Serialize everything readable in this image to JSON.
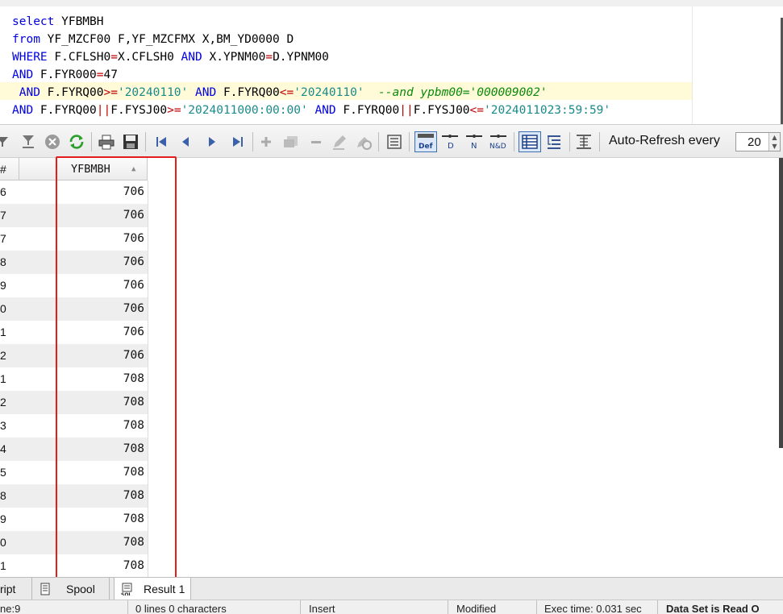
{
  "sql": {
    "lines": [
      [
        {
          "t": "select",
          "c": "kw"
        },
        {
          "t": " YFBMBH",
          "c": ""
        }
      ],
      [
        {
          "t": "from",
          "c": "kw"
        },
        {
          "t": " YF_MZCF00 F,YF_MZCFMX X,BM_YD0000 D",
          "c": ""
        }
      ],
      [
        {
          "t": "WHERE",
          "c": "kw"
        },
        {
          "t": " F.CFLSH0",
          "c": ""
        },
        {
          "t": "=",
          "c": "op"
        },
        {
          "t": "X.CFLSH0 ",
          "c": ""
        },
        {
          "t": "AND",
          "c": "kw"
        },
        {
          "t": " X.YPNM00",
          "c": ""
        },
        {
          "t": "=",
          "c": "op"
        },
        {
          "t": "D.YPNM00",
          "c": ""
        }
      ],
      [
        {
          "t": "AND",
          "c": "kw"
        },
        {
          "t": " F.FYR000",
          "c": ""
        },
        {
          "t": "=",
          "c": "op"
        },
        {
          "t": "47",
          "c": ""
        }
      ],
      [
        {
          "t": " AND",
          "c": "kw"
        },
        {
          "t": " F.FYRQ00",
          "c": ""
        },
        {
          "t": ">=",
          "c": "op"
        },
        {
          "t": "'20240110'",
          "c": "str"
        },
        {
          "t": " ",
          "c": ""
        },
        {
          "t": "AND",
          "c": "kw"
        },
        {
          "t": " F.FYRQ00",
          "c": ""
        },
        {
          "t": "<=",
          "c": "op"
        },
        {
          "t": "'20240110'",
          "c": "str"
        },
        {
          "t": "  --and ypbm00='000009002'",
          "c": "cm"
        }
      ],
      [
        {
          "t": "AND",
          "c": "kw"
        },
        {
          "t": " F.FYRQ00",
          "c": ""
        },
        {
          "t": "||",
          "c": "op"
        },
        {
          "t": "F.FYSJ00",
          "c": ""
        },
        {
          "t": ">=",
          "c": "op"
        },
        {
          "t": "'2024011000:00:00'",
          "c": "str"
        },
        {
          "t": " ",
          "c": ""
        },
        {
          "t": "AND",
          "c": "kw"
        },
        {
          "t": " F.FYRQ00",
          "c": ""
        },
        {
          "t": "||",
          "c": "op"
        },
        {
          "t": "F.FYSJ00",
          "c": ""
        },
        {
          "t": "<=",
          "c": "op"
        },
        {
          "t": "'2024011023:59:59'",
          "c": "str"
        }
      ]
    ]
  },
  "toolbar": {
    "icons": [
      "filter-icon",
      "filter-down-icon",
      "clear-icon",
      "refresh-icon",
      "print-icon",
      "save-icon",
      "first-record-icon",
      "prev-record-icon",
      "next-record-icon",
      "last-record-icon",
      "insert-record-icon",
      "duplicate-record-icon",
      "delete-record-icon",
      "post-edit-icon",
      "cancel-edit-icon",
      "form-view-icon",
      "default-view-icon",
      "detail-view-icon",
      "nested-view-icon",
      "detail-nested-view-icon",
      "grid-view-icon",
      "tree-view-icon",
      "auto-size-icon"
    ],
    "auto_refresh_label": "Auto-Refresh every",
    "auto_refresh_value": "20"
  },
  "grid": {
    "row_header": "#",
    "column_header": "YFBMBH",
    "rows": [
      {
        "n": "6",
        "v": "706"
      },
      {
        "n": "7",
        "v": "706"
      },
      {
        "n": "7",
        "v": "706"
      },
      {
        "n": "8",
        "v": "706"
      },
      {
        "n": "9",
        "v": "706"
      },
      {
        "n": "0",
        "v": "706"
      },
      {
        "n": "1",
        "v": "706"
      },
      {
        "n": "2",
        "v": "706"
      },
      {
        "n": "1",
        "v": "708"
      },
      {
        "n": "2",
        "v": "708"
      },
      {
        "n": "3",
        "v": "708"
      },
      {
        "n": "4",
        "v": "708"
      },
      {
        "n": "5",
        "v": "708"
      },
      {
        "n": "8",
        "v": "708"
      },
      {
        "n": "9",
        "v": "708"
      },
      {
        "n": "0",
        "v": "708"
      },
      {
        "n": "1",
        "v": "708"
      }
    ]
  },
  "tabs": {
    "script": "ript",
    "spool": "Spool",
    "result": "Result 1"
  },
  "status": {
    "line": "ne:9",
    "chars": "0 lines 0 characters",
    "mode": "Insert",
    "modified": "Modified",
    "exec_time": "Exec time: 0.031 sec",
    "dataset": "Data Set is Read O"
  },
  "colors": {
    "highlight": "#e51c1c",
    "keyword": "#0000e0",
    "string": "#1a8a8a",
    "comment": "#0a8a0a"
  }
}
